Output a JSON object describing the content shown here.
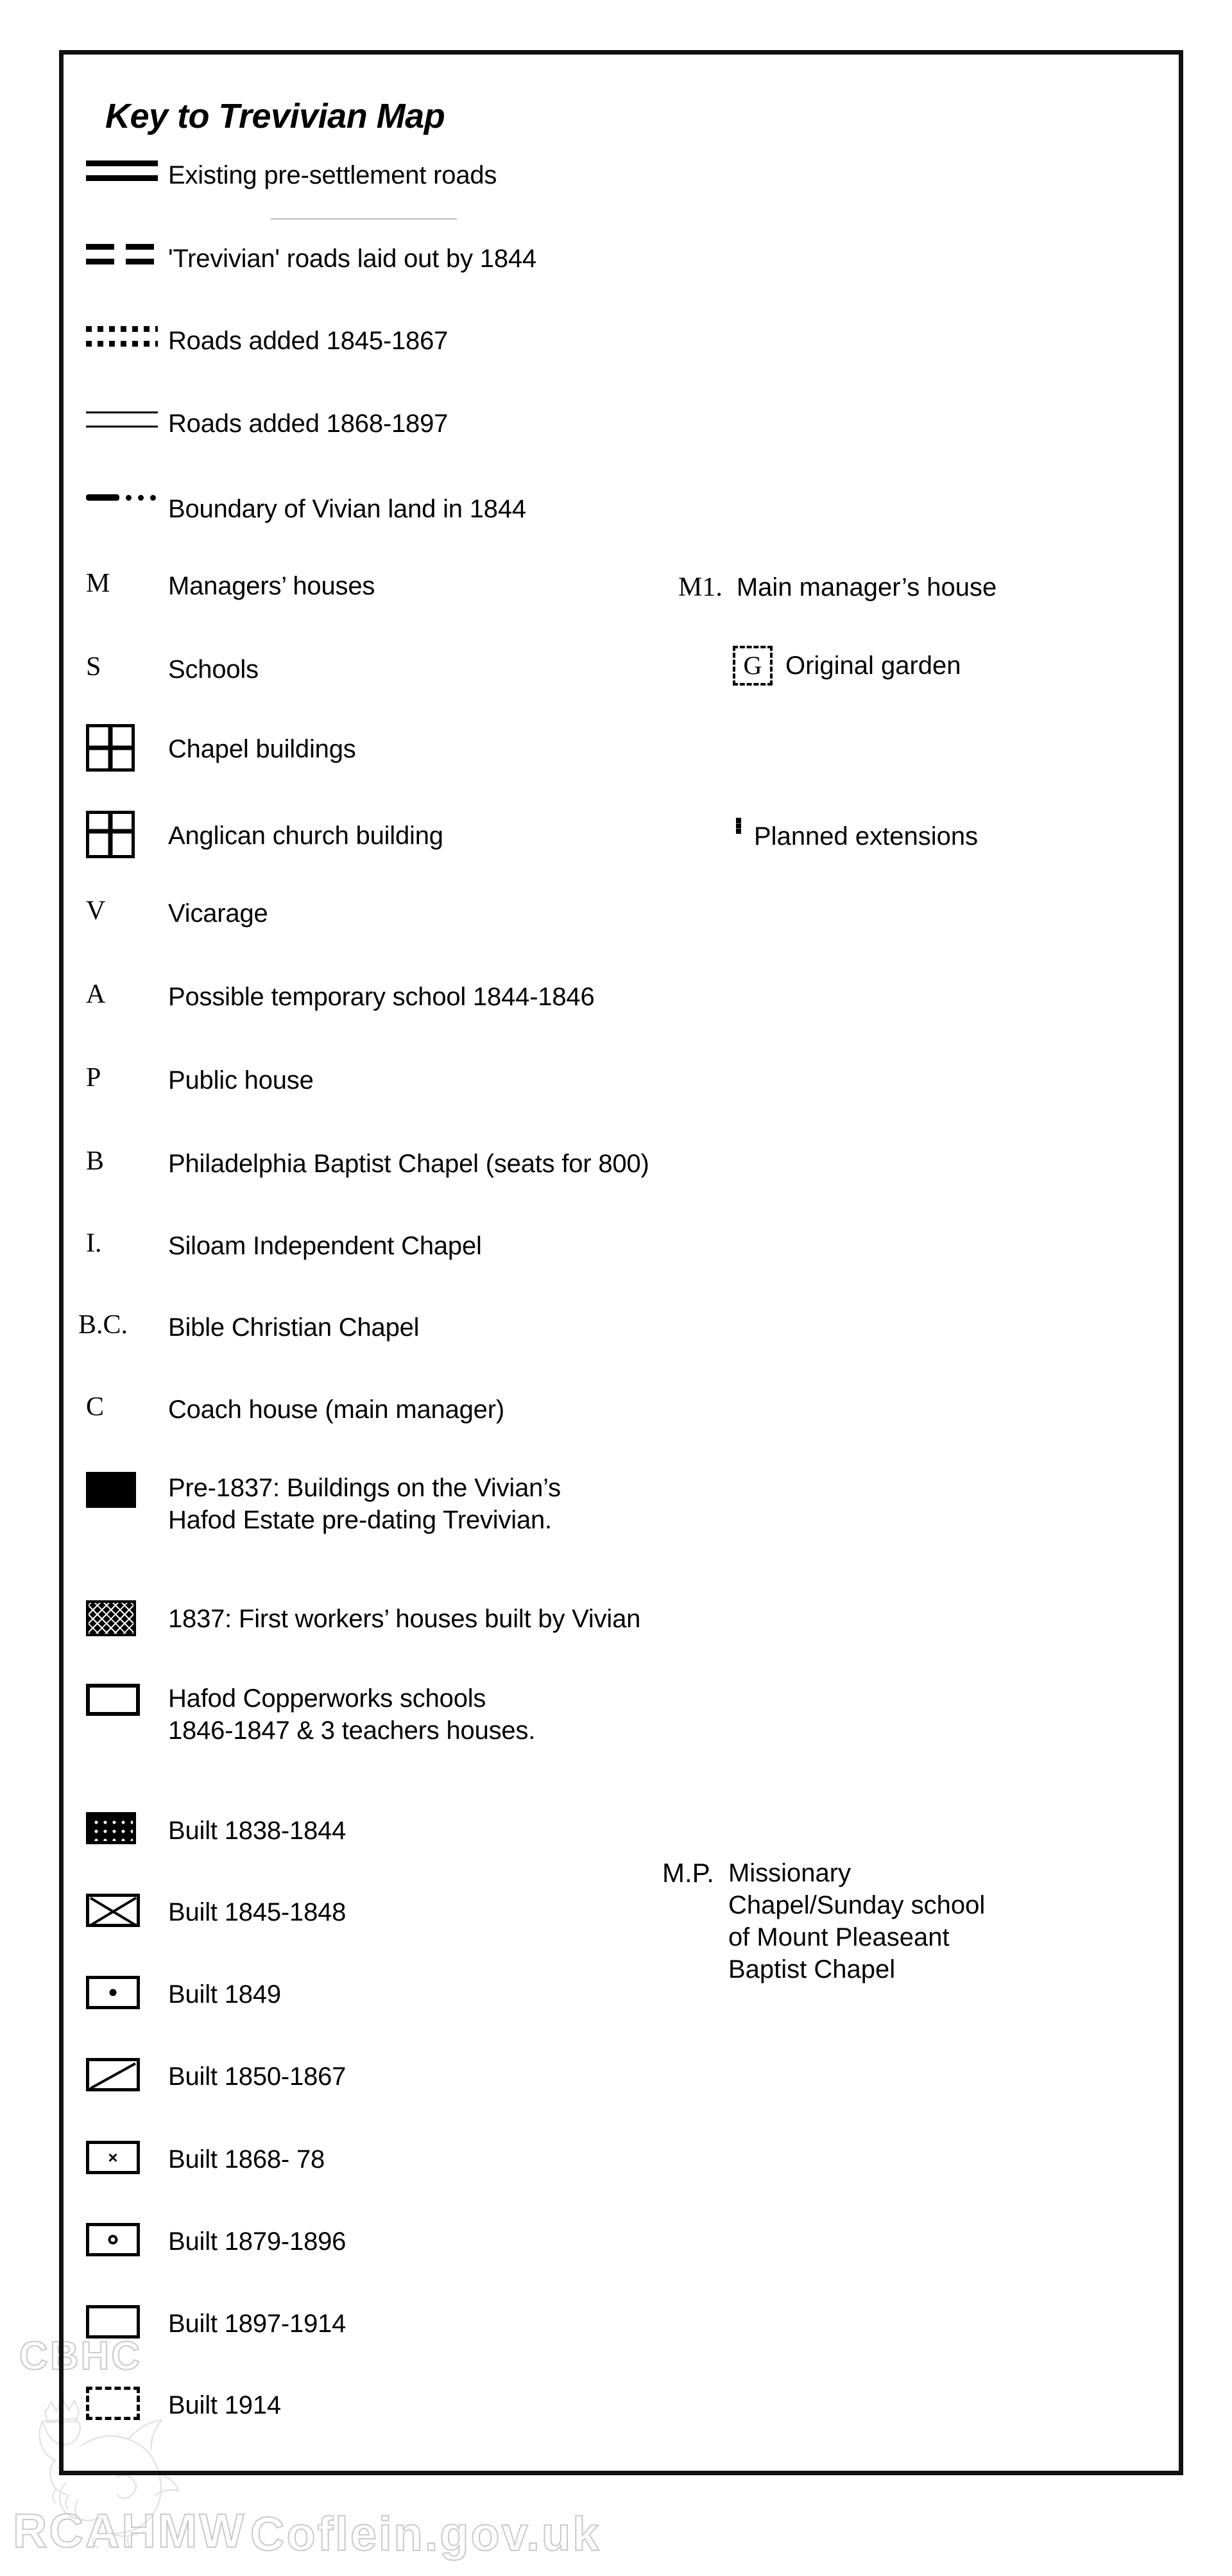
{
  "title": "Key to Trevivian Map",
  "legend_rows": [
    {
      "symbol": "double-solid-line",
      "label": "Existing pre-settlement roads"
    },
    {
      "symbol": "double-dashed-line",
      "label": "'Trevivian' roads laid out by 1844"
    },
    {
      "symbol": "double-dotted-line",
      "label": "Roads added 1845-1867"
    },
    {
      "symbol": "double-thin-line",
      "label": "Roads added 1868-1897"
    },
    {
      "symbol": "dash-dot-dot-line",
      "label": "Boundary of Vivian land in 1844"
    },
    {
      "symbol": "letter-M",
      "code": "M",
      "label": "Managers’ houses"
    },
    {
      "symbol": "letter-S",
      "code": "S",
      "label": "Schools"
    },
    {
      "symbol": "quad-box",
      "label": "Chapel buildings"
    },
    {
      "symbol": "quad-box-anglican",
      "label": "Anglican church building"
    },
    {
      "symbol": "letter-V",
      "code": "V",
      "label": "Vicarage"
    },
    {
      "symbol": "letter-A",
      "code": "A",
      "label": "Possible temporary school 1844-1846"
    },
    {
      "symbol": "letter-P",
      "code": "P",
      "label": "Public house"
    },
    {
      "symbol": "letter-B",
      "code": "B",
      "label": "Philadelphia Baptist Chapel (seats for 800)"
    },
    {
      "symbol": "letter-I",
      "code": "I.",
      "label": "Siloam Independent Chapel"
    },
    {
      "symbol": "letter-BC",
      "code": "B.C.",
      "label": "Bible Christian Chapel"
    },
    {
      "symbol": "letter-C",
      "code": "C",
      "label": "Coach house (main manager)"
    },
    {
      "symbol": "solid-black-square",
      "label": "Pre-1837: Buildings on the Vivian’s\nHafod Estate pre-dating Trevivian."
    },
    {
      "symbol": "mesh-square",
      "label": "1837: First workers’ houses built by Vivian"
    },
    {
      "symbol": "open-rectangle",
      "label": "Hafod Copperworks schools\n1846-1847 & 3 teachers houses."
    },
    {
      "symbol": "dotted-black-rectangle",
      "label": "Built 1838-1844"
    },
    {
      "symbol": "cross-rectangle",
      "label": "Built 1845-1848"
    },
    {
      "symbol": "centre-dot-rectangle",
      "label": "Built 1849"
    },
    {
      "symbol": "diagonal-slash-rectangle",
      "label": "Built 1850-1867"
    },
    {
      "symbol": "x-mark-rectangle",
      "label": "Built 1868- 78"
    },
    {
      "symbol": "ring-rectangle",
      "label": "Built 1879-1896"
    },
    {
      "symbol": "plain-rectangle",
      "label": "Built 1897-1914"
    },
    {
      "symbol": "dashed-rectangle",
      "label": "Built 1914"
    }
  ],
  "right_column": [
    {
      "code": "M1.",
      "label": "Main manager’s house",
      "symbol": "none"
    },
    {
      "code": "G",
      "label": "Original garden",
      "symbol": "dashed-box-with-G"
    },
    {
      "code": "",
      "label": "Planned extensions",
      "symbol": "dashed-rectangle"
    },
    {
      "code": "M.P.",
      "label": "Missionary\nChapel/Sunday school\nof Mount Pleaseant\nBaptist Chapel",
      "symbol": "none"
    }
  ],
  "watermark": {
    "cbhc": "CBHC",
    "rcahmw": "RCAHMW",
    "coflein": "Coflein.gov.uk",
    "crest": "welsh-dragon-crest"
  },
  "colors": {
    "ink": "#000000",
    "paper": "#ffffff",
    "watermark": "#c9c9c9",
    "rule": "#b9b9b9"
  }
}
